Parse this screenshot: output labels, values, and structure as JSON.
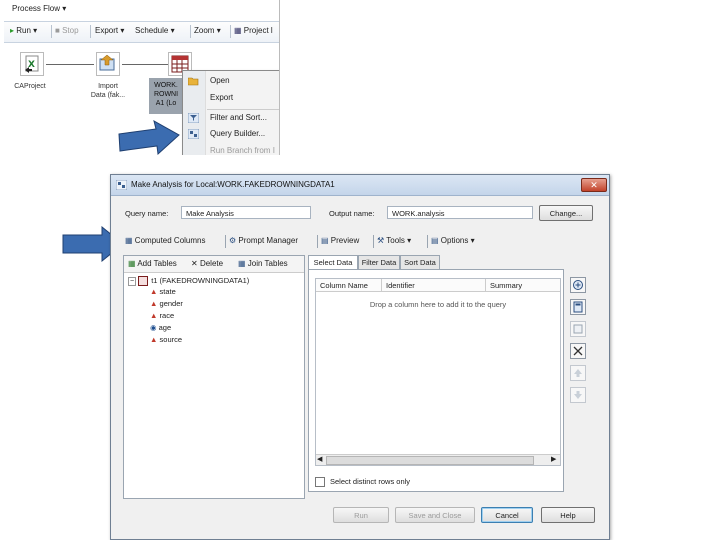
{
  "process_flow": {
    "title": "Process Flow ▾",
    "toolbar": {
      "run": "Run",
      "stop": "Stop",
      "export": "Export",
      "schedule": "Schedule",
      "zoom": "Zoom",
      "project": "Project l"
    },
    "nodes": {
      "n1_label": "CAProject",
      "n2_label_1": "Import",
      "n2_label_2": "Data (fak...",
      "n3_label_1": "WORK.",
      "n3_label_2": "ROWNI",
      "n3_label_3": "A1 (Lo"
    },
    "context_menu": {
      "open": "Open",
      "export": "Export",
      "filter_sort": "Filter and Sort...",
      "query_builder": "Query Builder...",
      "run_branch": "Run Branch from I"
    }
  },
  "dialog": {
    "title": "Make Analysis for Local:WORK.FAKEDROWNINGDATA1",
    "query_name_label": "Query name:",
    "query_name_value": "Make Analysis",
    "output_name_label": "Output name:",
    "output_name_value": "WORK.analysis",
    "change_button": "Change...",
    "toolbar": {
      "computed_columns": "Computed Columns",
      "prompt_manager": "Prompt Manager",
      "preview": "Preview",
      "tools": "Tools ▾",
      "options": "Options ▾"
    },
    "left_toolbar": {
      "add_tables": "Add Tables",
      "delete": "Delete",
      "join_tables": "Join Tables"
    },
    "tree": {
      "root": "t1 (FAKEDROWNINGDATA1)",
      "columns": [
        "state",
        "gender",
        "race",
        "age",
        "source"
      ]
    },
    "tabs": {
      "select_data": "Select Data",
      "filter_data": "Filter Data",
      "sort_data": "Sort Data"
    },
    "grid": {
      "headers": [
        "Column Name",
        "Identifier",
        "Summary"
      ],
      "empty_message": "Drop a column here to add it to the query"
    },
    "distinct_rows": "Select distinct rows only",
    "buttons": {
      "run": "Run",
      "save_close": "Save and Close",
      "cancel": "Cancel",
      "help": "Help"
    }
  }
}
